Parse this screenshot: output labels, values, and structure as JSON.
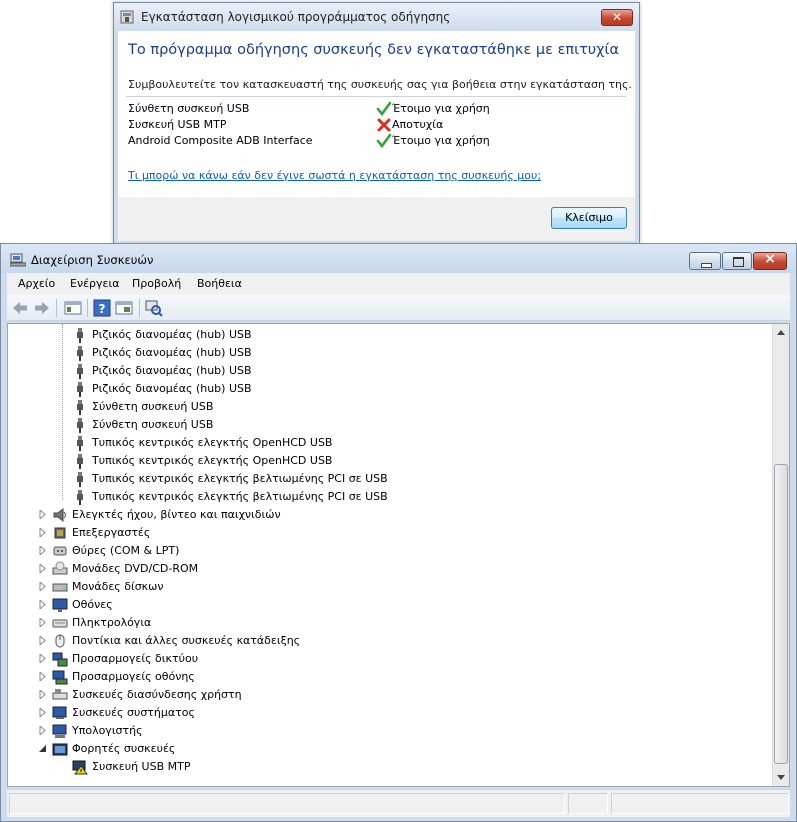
{
  "dialog": {
    "title": "Εγκατάσταση λογισμικού προγράμματος οδήγησης",
    "heading": "Το πρόγραμμα οδήγησης συσκευής δεν εγκαταστάθηκε με επιτυχία",
    "advice": "Συμβουλευτείτε τον κατασκευαστή της συσκευής σας για βοήθεια στην εγκατάσταση της.",
    "devices": [
      {
        "name": "Σύνθετη συσκευή USB",
        "status": "Έτοιμο για χρήση",
        "status_icon": "checkmark-icon"
      },
      {
        "name": "Συσκευή USB MTP",
        "status": "Αποτυχία",
        "status_icon": "red-x-icon"
      },
      {
        "name": "Android Composite ADB Interface",
        "status": "Έτοιμο για χρήση",
        "status_icon": "checkmark-icon"
      }
    ],
    "help_link": "Τι μπορώ να κάνω εάν δεν έγινε σωστά η εγκατάσταση της συσκευής μου;",
    "close_button": "Κλείσιμο"
  },
  "device_manager": {
    "title": "Διαχείριση Συσκευών",
    "menu": [
      "Αρχείο",
      "Ενέργεια",
      "Προβολή",
      "Βοήθεια"
    ],
    "usb_children": [
      "Ριζικός διανομέας (hub) USB",
      "Ριζικός διανομέας (hub) USB",
      "Ριζικός διανομέας (hub) USB",
      "Ριζικός διανομέας (hub) USB",
      "Σύνθετη συσκευή USB",
      "Σύνθετη συσκευή USB",
      "Τυπικός κεντρικός ελεγκτής OpenHCD USB",
      "Τυπικός κεντρικός ελεγκτής OpenHCD USB",
      "Τυπικός κεντρικός ελεγκτής βελτιωμένης PCI σε USB",
      "Τυπικός κεντρικός ελεγκτής βελτιωμένης PCI σε USB"
    ],
    "categories": [
      "Ελεγκτές ήχου, βίντεο και παιχνιδιών",
      "Επεξεργαστές",
      "Θύρες (COM & LPT)",
      "Μονάδες DVD/CD-ROM",
      "Μονάδες δίσκων",
      "Οθόνες",
      "Πληκτρολόγια",
      "Ποντίκια και άλλες συσκευές κατάδειξης",
      "Προσαρμογείς δικτύου",
      "Προσαρμογείς οθόνης",
      "Συσκευές διασύνδεσης χρήστη",
      "Συσκευές συστήματος",
      "Υπολογιστής",
      "Φορητές συσκευές"
    ],
    "portable_child": "Συσκευή USB MTP"
  }
}
